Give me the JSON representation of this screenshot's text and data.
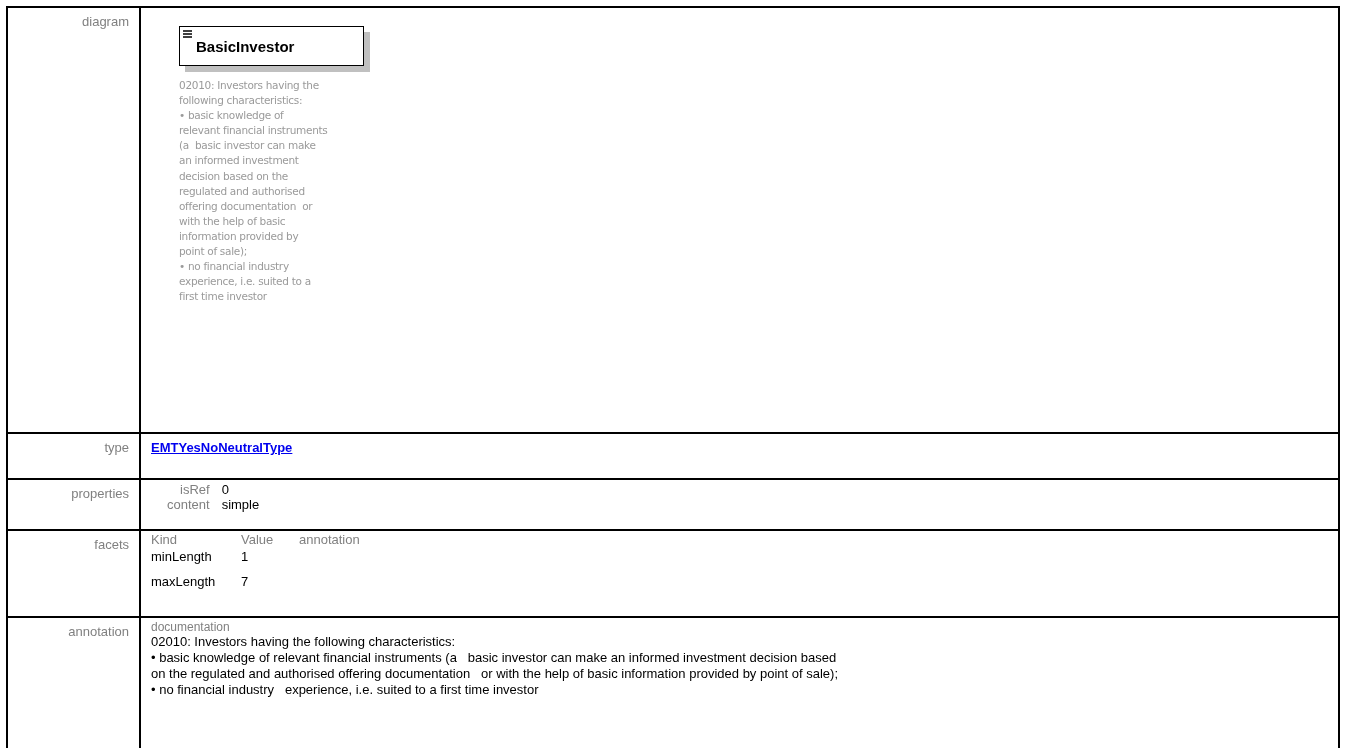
{
  "rows": [
    {
      "kind": "diagram",
      "label": "diagram",
      "element": "BasicInvestor",
      "doc_lines": [
        "02010: Investors having the",
        "following characteristics:",
        "• basic knowledge of",
        "relevant financial instruments",
        "(a  basic investor can make",
        "an informed investment",
        "decision based on the",
        "regulated and authorised",
        "offering documentation  or",
        "with the help of basic",
        "information provided by",
        "point of sale);",
        "• no financial industry",
        "experience, i.e. suited to a",
        "first time investor"
      ]
    },
    {
      "kind": "type",
      "label": "type",
      "link": "EMTYesNoNeutralType"
    },
    {
      "kind": "properties",
      "label": "properties",
      "items": [
        {
          "name": "isRef",
          "value": "0"
        },
        {
          "name": "content",
          "value": "simple"
        }
      ]
    },
    {
      "kind": "facets",
      "label": "facets",
      "columns": [
        "Kind",
        "Value",
        "annotation"
      ],
      "items": [
        {
          "kind": "minLength",
          "value": "1"
        },
        {
          "kind": "maxLength",
          "value": "7"
        }
      ]
    },
    {
      "kind": "annotation",
      "label": "annotation",
      "heading": "documentation",
      "lines": [
        "02010: Investors having the following characteristics:",
        "• basic knowledge of relevant financial instruments (a   basic investor can make an informed investment decision based",
        "on the regulated and authorised offering documentation   or with the help of basic information provided by point of sale);",
        "• no financial industry   experience, i.e. suited to a first time investor"
      ]
    }
  ]
}
